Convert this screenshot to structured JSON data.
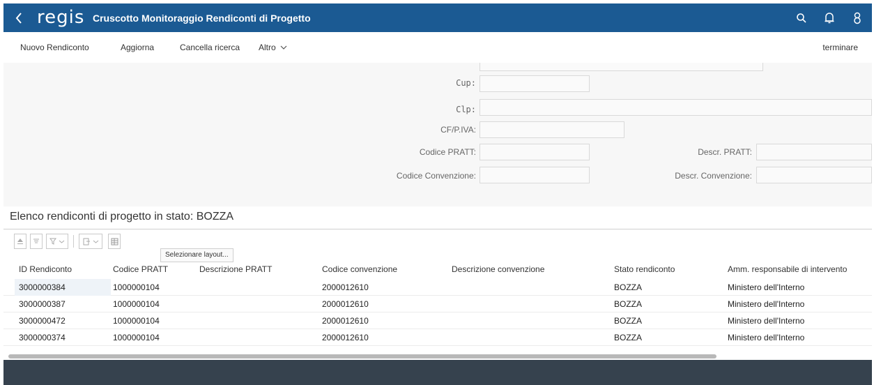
{
  "header": {
    "back_icon": "chevron-left-icon",
    "logo": "regis",
    "title": "Cruscotto Monitoraggio Rendiconti di Progetto",
    "icons": [
      "search-icon",
      "bell-icon",
      "user-icon"
    ],
    "color": "#1b5a93"
  },
  "toolbar": {
    "new": "Nuovo Rendiconto",
    "refresh": "Aggiorna",
    "clear": "Cancella ricerca",
    "more": "Altro",
    "exit": "terminare"
  },
  "form": {
    "cup_label": "Cup:",
    "clp_label": "Clp:",
    "cf_label": "CF/P.IVA:",
    "codice_pratt_label": "Codice PRATT:",
    "descr_pratt_label": "Descr. PRATT:",
    "codice_conv_label": "Codice Convenzione:",
    "descr_conv_label": "Descr. Convenzione:"
  },
  "list": {
    "title": "Elenco rendiconti di progetto in stato: BOZZA",
    "tooltip": "Selezionare layout...",
    "columns": [
      "ID Rendiconto",
      "Codice PRATT",
      "Descrizione PRATT",
      "Codice convenzione",
      "Descrizione convenzione",
      "Stato rendiconto",
      "Amm. responsabile di intervento"
    ],
    "rows": [
      {
        "id": "3000000384",
        "pratt": "1000000104",
        "desc_pratt": "",
        "conv": "2000012610",
        "desc_conv": "",
        "stato": "BOZZA",
        "amm": "Ministero dell'Interno"
      },
      {
        "id": "3000000387",
        "pratt": "1000000104",
        "desc_pratt": "",
        "conv": "2000012610",
        "desc_conv": "",
        "stato": "BOZZA",
        "amm": "Ministero dell'Interno"
      },
      {
        "id": "3000000472",
        "pratt": "1000000104",
        "desc_pratt": "",
        "conv": "2000012610",
        "desc_conv": "",
        "stato": "BOZZA",
        "amm": "Ministero dell'Interno"
      },
      {
        "id": "3000000374",
        "pratt": "1000000104",
        "desc_pratt": "",
        "conv": "2000012610",
        "desc_conv": "",
        "stato": "BOZZA",
        "amm": "Ministero dell'Interno"
      }
    ]
  }
}
